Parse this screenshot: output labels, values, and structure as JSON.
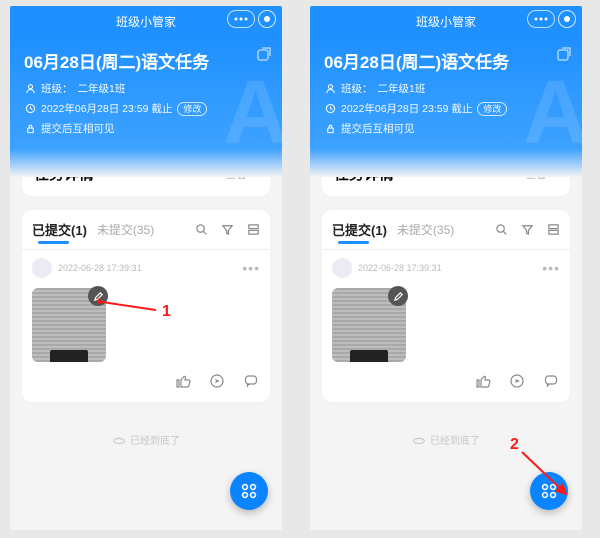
{
  "app_title": "班级小管家",
  "header": {
    "title": "06月28日(周二)语文任务",
    "class_label": "班级：",
    "class_value": "二年级1班",
    "deadline_label": "2022年06月28日 23:59 截止",
    "modify_btn": "修改",
    "visibility": "提交后互相可见"
  },
  "details": {
    "title": "任务详情",
    "view": "查看"
  },
  "submissions": {
    "tab_submitted_label": "已提交",
    "tab_submitted_count": "(1)",
    "tab_unsubmitted_label": "未提交",
    "tab_unsubmitted_count": "(35)"
  },
  "post": {
    "timestamp": "2022-06-28 17:39:31"
  },
  "footer": {
    "text": "已经到底了"
  },
  "annotations": {
    "one": "1",
    "two": "2"
  }
}
